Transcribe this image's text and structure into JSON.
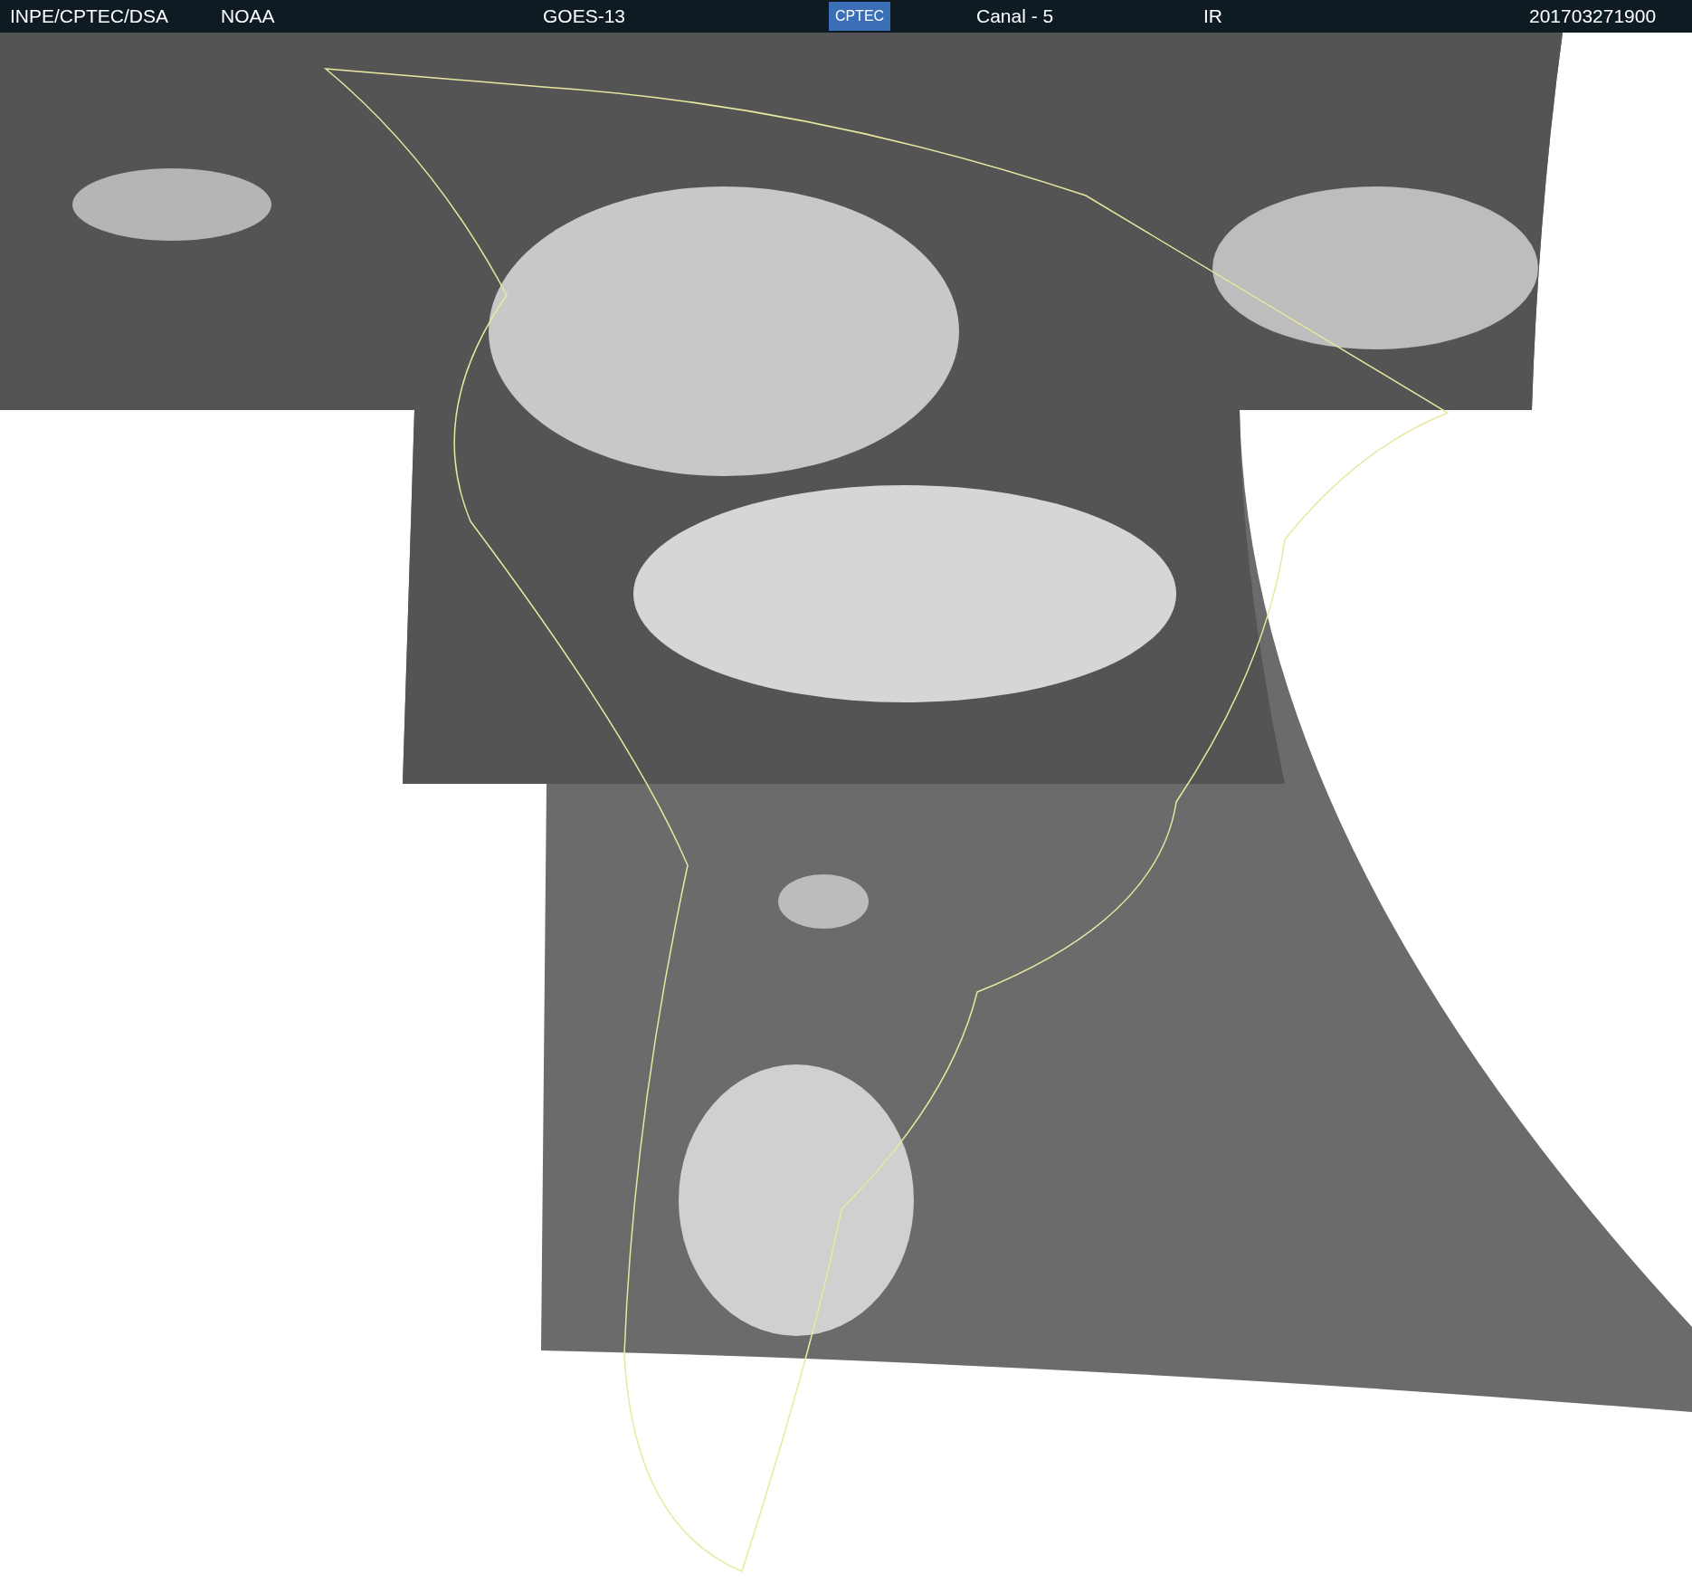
{
  "header": {
    "source": "INPE/CPTEC/DSA",
    "agency": "NOAA",
    "satellite": "GOES-13",
    "logo": "CPTEC",
    "channel": "Canal - 5",
    "band": "IR",
    "timestamp": "201703271900"
  }
}
